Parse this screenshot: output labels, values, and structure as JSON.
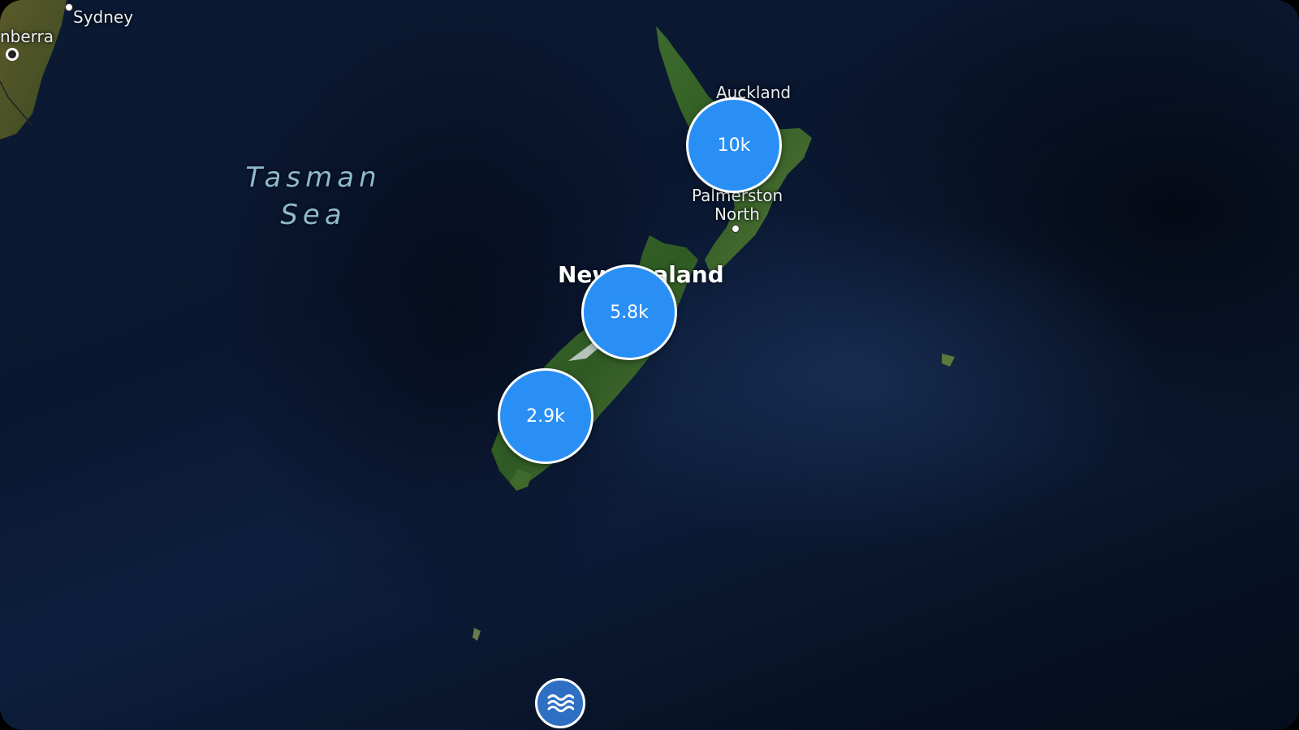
{
  "map": {
    "places": {
      "sydney": "Sydney",
      "canberra": "nberra",
      "auckland": "Auckland",
      "palmerston_north_line1": "Palmerston",
      "palmerston_north_line2": "North",
      "country": "New Zealand"
    },
    "sea": {
      "line1": "Tasman",
      "line2": "Sea"
    },
    "clusters": [
      {
        "label": "10k"
      },
      {
        "label": "5.8k"
      },
      {
        "label": "2.9k"
      }
    ],
    "marker_icon": "waves-icon",
    "colors": {
      "cluster_fill": "#2a8ff5",
      "cluster_border": "#ffffff",
      "marker_fill": "#2f6fc2",
      "sea_label": "#8fb8cf"
    }
  }
}
